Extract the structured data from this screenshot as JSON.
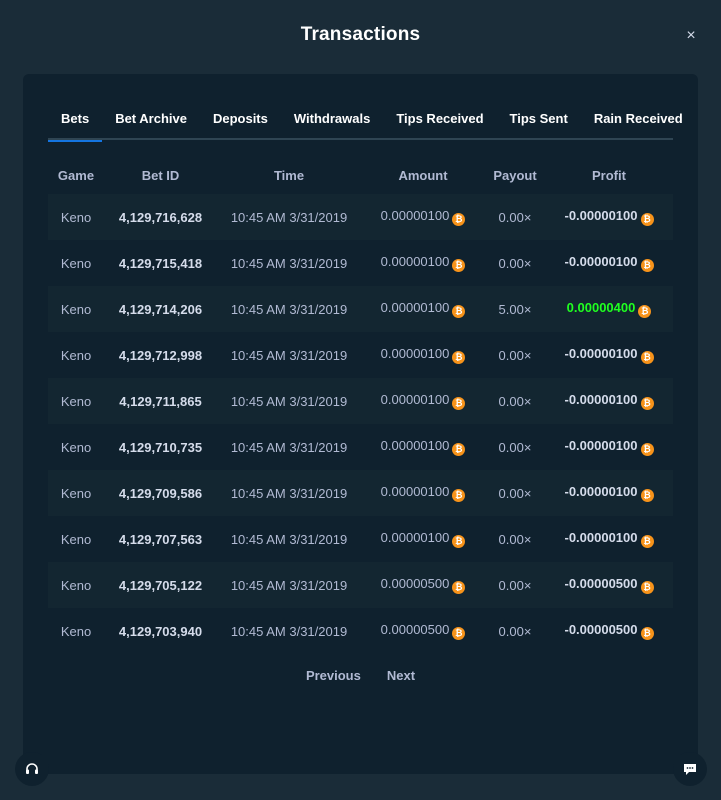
{
  "modal": {
    "title": "Transactions",
    "close_label": "×"
  },
  "tabs": [
    {
      "label": "Bets",
      "active": true
    },
    {
      "label": "Bet Archive"
    },
    {
      "label": "Deposits"
    },
    {
      "label": "Withdrawals"
    },
    {
      "label": "Tips Received"
    },
    {
      "label": "Tips Sent"
    },
    {
      "label": "Rain Received"
    }
  ],
  "table": {
    "headers": {
      "game": "Game",
      "bet_id": "Bet ID",
      "time": "Time",
      "amount": "Amount",
      "payout": "Payout",
      "profit": "Profit"
    },
    "currency_icon": "bitcoin-icon",
    "rows": [
      {
        "game": "Keno",
        "bet_id": "4,129,716,628",
        "time": "10:45 AM 3/31/2019",
        "amount": "0.00000100",
        "payout": "0.00×",
        "profit": "-0.00000100"
      },
      {
        "game": "Keno",
        "bet_id": "4,129,715,418",
        "time": "10:45 AM 3/31/2019",
        "amount": "0.00000100",
        "payout": "0.00×",
        "profit": "-0.00000100"
      },
      {
        "game": "Keno",
        "bet_id": "4,129,714,206",
        "time": "10:45 AM 3/31/2019",
        "amount": "0.00000100",
        "payout": "5.00×",
        "profit": "0.00000400"
      },
      {
        "game": "Keno",
        "bet_id": "4,129,712,998",
        "time": "10:45 AM 3/31/2019",
        "amount": "0.00000100",
        "payout": "0.00×",
        "profit": "-0.00000100"
      },
      {
        "game": "Keno",
        "bet_id": "4,129,711,865",
        "time": "10:45 AM 3/31/2019",
        "amount": "0.00000100",
        "payout": "0.00×",
        "profit": "-0.00000100"
      },
      {
        "game": "Keno",
        "bet_id": "4,129,710,735",
        "time": "10:45 AM 3/31/2019",
        "amount": "0.00000100",
        "payout": "0.00×",
        "profit": "-0.00000100"
      },
      {
        "game": "Keno",
        "bet_id": "4,129,709,586",
        "time": "10:45 AM 3/31/2019",
        "amount": "0.00000100",
        "payout": "0.00×",
        "profit": "-0.00000100"
      },
      {
        "game": "Keno",
        "bet_id": "4,129,707,563",
        "time": "10:45 AM 3/31/2019",
        "amount": "0.00000100",
        "payout": "0.00×",
        "profit": "-0.00000100"
      },
      {
        "game": "Keno",
        "bet_id": "4,129,705,122",
        "time": "10:45 AM 3/31/2019",
        "amount": "0.00000500",
        "payout": "0.00×",
        "profit": "-0.00000500"
      },
      {
        "game": "Keno",
        "bet_id": "4,129,703,940",
        "time": "10:45 AM 3/31/2019",
        "amount": "0.00000500",
        "payout": "0.00×",
        "profit": "-0.00000500"
      }
    ]
  },
  "pagination": {
    "previous_label": "Previous",
    "next_label": "Next"
  },
  "colors": {
    "positive_profit": "#1fff20",
    "accent_tab": "#1475e1",
    "coin": "#f7931a"
  },
  "floating": {
    "support_icon": "headset-icon",
    "chat_icon": "chat-icon"
  }
}
